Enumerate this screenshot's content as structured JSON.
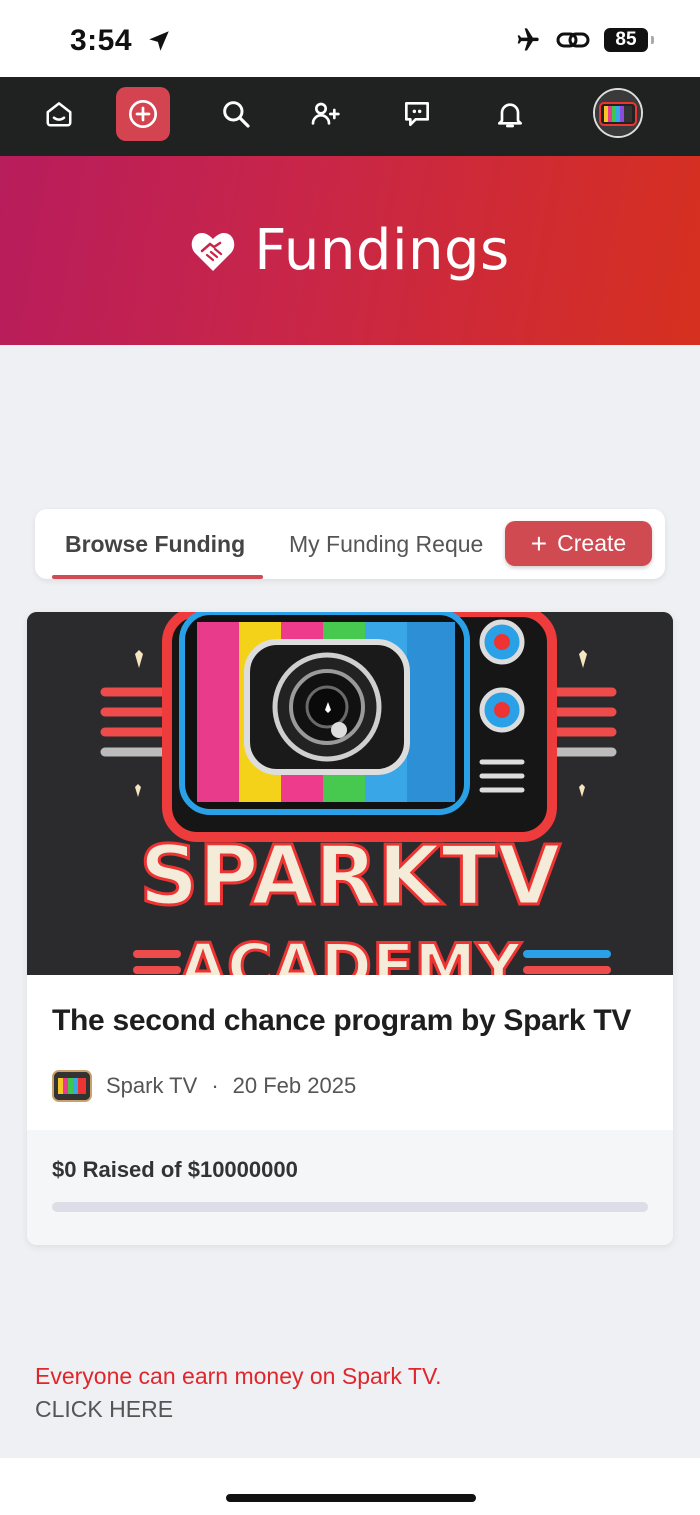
{
  "status_bar": {
    "time": "3:54",
    "battery": "85"
  },
  "nav": {
    "items": [
      "home",
      "create",
      "search",
      "add-friend",
      "messages",
      "notifications",
      "profile"
    ]
  },
  "hero": {
    "title": "Fundings"
  },
  "tabs": {
    "browse": "Browse Funding",
    "my_requests": "My Funding Reque",
    "create": "Create"
  },
  "card": {
    "image_title": "SPARKTV",
    "image_subtitle": "ACADEMY",
    "title": "The second chance program by Spark TV",
    "author": "Spark TV",
    "separator": "·",
    "date": "20 Feb 2025",
    "raised_text": "$0 Raised of $10000000",
    "raised_fraction": 0
  },
  "promo": {
    "text": "Everyone can earn money on Spark TV.",
    "link": "CLICK HERE"
  },
  "colors": {
    "accent": "#d04a52",
    "nav_bg": "#1f2221",
    "hero_start": "#b81d5c",
    "hero_end": "#d6301f",
    "promo_text": "#e0262a"
  }
}
